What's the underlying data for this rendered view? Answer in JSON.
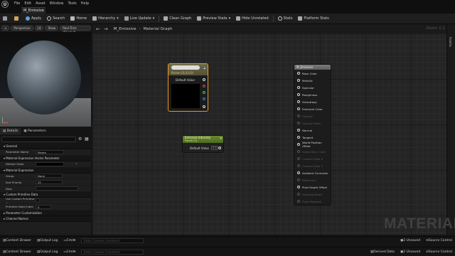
{
  "menu": [
    "File",
    "Edit",
    "Asset",
    "Window",
    "Tools",
    "Help"
  ],
  "document_tab": "M_Emissive",
  "toolbar": {
    "save": "Save",
    "browse": "Browse",
    "apply": "Apply",
    "search": "Search",
    "home": "Home",
    "hierarchy": "Hierarchy",
    "live_update": "Live Update",
    "clean_graph": "Clean Graph",
    "preview_state": "Preview State",
    "hide_unrelated": "Hide Unrelated",
    "stats": "Stats",
    "platform_stats": "Platform Stats"
  },
  "viewport": {
    "pills": [
      "Perspective",
      "Lit",
      "Show",
      "Real-Time (Shaded)"
    ]
  },
  "details": {
    "tabs": [
      "Details",
      "Parameters"
    ],
    "sections": [
      {
        "title": "General",
        "props": [
          {
            "label": "Parameter Name",
            "value": "Param"
          }
        ]
      },
      {
        "title": "Material Expression Vector Parameter",
        "props": [
          {
            "label": "Default Value",
            "value": ""
          }
        ]
      },
      {
        "title": "Material Expression",
        "props": [
          {
            "label": "Group",
            "value": "None"
          },
          {
            "label": "Sort Priority",
            "value": "32"
          },
          {
            "label": "Desc",
            "value": ""
          }
        ]
      },
      {
        "title": "Custom Primitive Data",
        "props": [
          {
            "label": "Use Custom Primitive ...",
            "value": ""
          },
          {
            "label": "Primitive Data Index",
            "value": "0"
          }
        ]
      },
      {
        "title": "Parameter Customization",
        "props": []
      },
      {
        "title": "Channel Names",
        "props": []
      }
    ]
  },
  "graph": {
    "breadcrumb": "M_Emissive",
    "title": "Material Graph",
    "zoom": "Zoom 1:1",
    "watermark": "MATERIAL",
    "right_panel": "Palette"
  },
  "param_node": {
    "type_label": "Param (0,0,0,0)",
    "default_label": "Default Value"
  },
  "scalar_node": {
    "title": "Emissive Intensity",
    "subtitle": "Param (1)",
    "default_label": "Default Value",
    "value": "0.0"
  },
  "output_node": {
    "title": "M_Emissive",
    "pins": [
      {
        "label": "Base Color",
        "enabled": true
      },
      {
        "label": "Metallic",
        "enabled": true
      },
      {
        "label": "Specular",
        "enabled": true
      },
      {
        "label": "Roughness",
        "enabled": true
      },
      {
        "label": "Anisotropy",
        "enabled": true
      },
      {
        "label": "Emissive Color",
        "enabled": true
      },
      {
        "label": "Opacity",
        "enabled": false
      },
      {
        "label": "Opacity Mask",
        "enabled": false
      },
      {
        "label": "Normal",
        "enabled": true
      },
      {
        "label": "Tangent",
        "enabled": true
      },
      {
        "label": "World Position Offset",
        "enabled": true
      },
      {
        "label": "Subsurface Color",
        "enabled": false
      },
      {
        "label": "Custom Data 0",
        "enabled": false
      },
      {
        "label": "Custom Data 1",
        "enabled": false
      },
      {
        "label": "Ambient Occlusion",
        "enabled": true
      },
      {
        "label": "Refraction",
        "enabled": false
      },
      {
        "label": "Pixel Depth Offset",
        "enabled": true
      },
      {
        "label": "Shading Model",
        "enabled": false
      },
      {
        "label": "Front Material",
        "enabled": false
      }
    ]
  },
  "bottom": {
    "row1": {
      "drawer": "Content Drawer",
      "log": "Output Log",
      "cmd": "Cmd",
      "placeholder": "Enter Console Command",
      "unsaved": "2 Unsaved",
      "source": "Source Control"
    },
    "row2": {
      "drawer": "Content Drawer",
      "log": "Output Log",
      "cmd": "Cmd",
      "placeholder": "Enter Console Command",
      "derived": "Derived Data",
      "unsaved": "2 Unsaved",
      "source": "Source Control"
    }
  }
}
